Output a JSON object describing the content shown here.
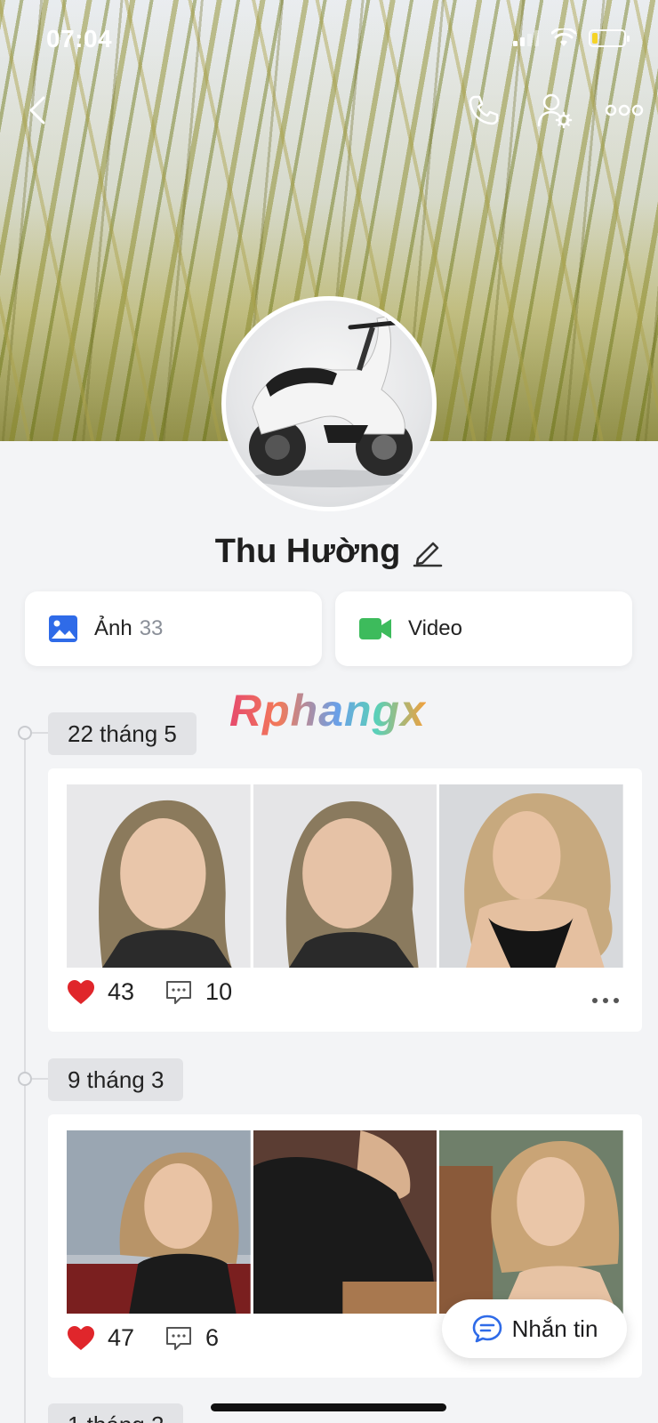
{
  "status_bar": {
    "time": "07:04"
  },
  "profile": {
    "name": "Thu Hường"
  },
  "media": {
    "photos_label": "Ảnh",
    "photos_count": "33",
    "video_label": "Video"
  },
  "watermark": "Rphangx",
  "posts": [
    {
      "date": "22 tháng 5",
      "likes": "43",
      "comments": "10"
    },
    {
      "date": "9 tháng 3",
      "likes": "47",
      "comments": "6"
    },
    {
      "date": "1 tháng 2"
    }
  ],
  "chat_button": {
    "label": "Nhắn tin"
  },
  "colors": {
    "like": "#e0262b",
    "photo_icon": "#2f6be8",
    "video_icon": "#3dbb5c",
    "chat_icon": "#2f6be8"
  },
  "icons": [
    "back-icon",
    "phone-icon",
    "user-settings-icon",
    "more-icon",
    "edit-icon",
    "image-icon",
    "video-camera-icon",
    "heart-icon",
    "comment-icon",
    "chat-bubble-icon"
  ]
}
